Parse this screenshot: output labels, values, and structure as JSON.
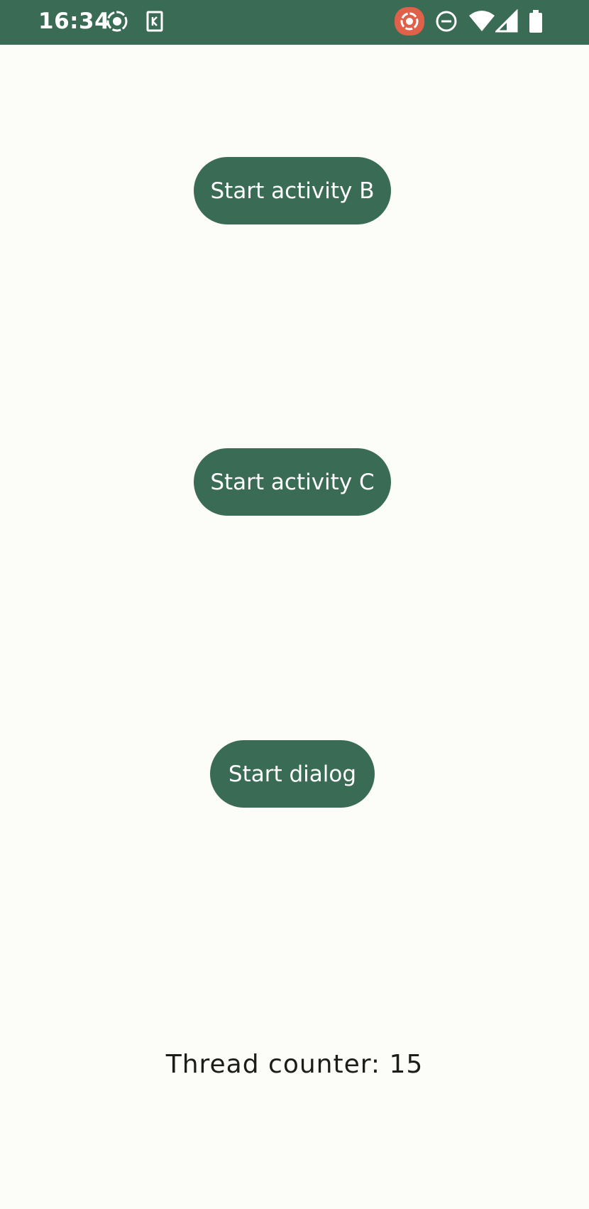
{
  "status_bar": {
    "time": "16:34",
    "icons": [
      "record-icon",
      "keyboard-icon",
      "screen-record-icon",
      "do-not-disturb-icon",
      "wifi-icon",
      "cell-signal-icon",
      "battery-icon"
    ],
    "accent": "#3a6b55",
    "record_badge_color": "#e0614a"
  },
  "main": {
    "buttons": [
      {
        "label": "Start activity B"
      },
      {
        "label": "Start activity C"
      },
      {
        "label": "Start dialog"
      }
    ],
    "counter_text": "Thread counter: 15"
  },
  "colors": {
    "background": "#fcfcf8",
    "button": "#3a6b55",
    "button_text": "#ffffff",
    "text": "#1c1c1a"
  }
}
